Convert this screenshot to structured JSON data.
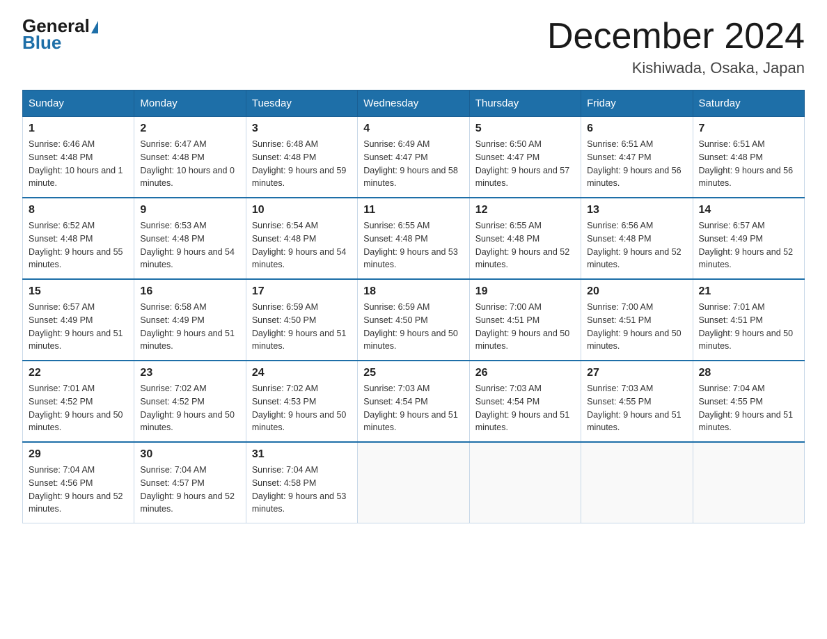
{
  "logo": {
    "general": "General",
    "blue": "Blue"
  },
  "title": "December 2024",
  "location": "Kishiwada, Osaka, Japan",
  "days_of_week": [
    "Sunday",
    "Monday",
    "Tuesday",
    "Wednesday",
    "Thursday",
    "Friday",
    "Saturday"
  ],
  "weeks": [
    [
      {
        "day": "1",
        "sunrise": "6:46 AM",
        "sunset": "4:48 PM",
        "daylight": "10 hours and 1 minute."
      },
      {
        "day": "2",
        "sunrise": "6:47 AM",
        "sunset": "4:48 PM",
        "daylight": "10 hours and 0 minutes."
      },
      {
        "day": "3",
        "sunrise": "6:48 AM",
        "sunset": "4:48 PM",
        "daylight": "9 hours and 59 minutes."
      },
      {
        "day": "4",
        "sunrise": "6:49 AM",
        "sunset": "4:47 PM",
        "daylight": "9 hours and 58 minutes."
      },
      {
        "day": "5",
        "sunrise": "6:50 AM",
        "sunset": "4:47 PM",
        "daylight": "9 hours and 57 minutes."
      },
      {
        "day": "6",
        "sunrise": "6:51 AM",
        "sunset": "4:47 PM",
        "daylight": "9 hours and 56 minutes."
      },
      {
        "day": "7",
        "sunrise": "6:51 AM",
        "sunset": "4:48 PM",
        "daylight": "9 hours and 56 minutes."
      }
    ],
    [
      {
        "day": "8",
        "sunrise": "6:52 AM",
        "sunset": "4:48 PM",
        "daylight": "9 hours and 55 minutes."
      },
      {
        "day": "9",
        "sunrise": "6:53 AM",
        "sunset": "4:48 PM",
        "daylight": "9 hours and 54 minutes."
      },
      {
        "day": "10",
        "sunrise": "6:54 AM",
        "sunset": "4:48 PM",
        "daylight": "9 hours and 54 minutes."
      },
      {
        "day": "11",
        "sunrise": "6:55 AM",
        "sunset": "4:48 PM",
        "daylight": "9 hours and 53 minutes."
      },
      {
        "day": "12",
        "sunrise": "6:55 AM",
        "sunset": "4:48 PM",
        "daylight": "9 hours and 52 minutes."
      },
      {
        "day": "13",
        "sunrise": "6:56 AM",
        "sunset": "4:48 PM",
        "daylight": "9 hours and 52 minutes."
      },
      {
        "day": "14",
        "sunrise": "6:57 AM",
        "sunset": "4:49 PM",
        "daylight": "9 hours and 52 minutes."
      }
    ],
    [
      {
        "day": "15",
        "sunrise": "6:57 AM",
        "sunset": "4:49 PM",
        "daylight": "9 hours and 51 minutes."
      },
      {
        "day": "16",
        "sunrise": "6:58 AM",
        "sunset": "4:49 PM",
        "daylight": "9 hours and 51 minutes."
      },
      {
        "day": "17",
        "sunrise": "6:59 AM",
        "sunset": "4:50 PM",
        "daylight": "9 hours and 51 minutes."
      },
      {
        "day": "18",
        "sunrise": "6:59 AM",
        "sunset": "4:50 PM",
        "daylight": "9 hours and 50 minutes."
      },
      {
        "day": "19",
        "sunrise": "7:00 AM",
        "sunset": "4:51 PM",
        "daylight": "9 hours and 50 minutes."
      },
      {
        "day": "20",
        "sunrise": "7:00 AM",
        "sunset": "4:51 PM",
        "daylight": "9 hours and 50 minutes."
      },
      {
        "day": "21",
        "sunrise": "7:01 AM",
        "sunset": "4:51 PM",
        "daylight": "9 hours and 50 minutes."
      }
    ],
    [
      {
        "day": "22",
        "sunrise": "7:01 AM",
        "sunset": "4:52 PM",
        "daylight": "9 hours and 50 minutes."
      },
      {
        "day": "23",
        "sunrise": "7:02 AM",
        "sunset": "4:52 PM",
        "daylight": "9 hours and 50 minutes."
      },
      {
        "day": "24",
        "sunrise": "7:02 AM",
        "sunset": "4:53 PM",
        "daylight": "9 hours and 50 minutes."
      },
      {
        "day": "25",
        "sunrise": "7:03 AM",
        "sunset": "4:54 PM",
        "daylight": "9 hours and 51 minutes."
      },
      {
        "day": "26",
        "sunrise": "7:03 AM",
        "sunset": "4:54 PM",
        "daylight": "9 hours and 51 minutes."
      },
      {
        "day": "27",
        "sunrise": "7:03 AM",
        "sunset": "4:55 PM",
        "daylight": "9 hours and 51 minutes."
      },
      {
        "day": "28",
        "sunrise": "7:04 AM",
        "sunset": "4:55 PM",
        "daylight": "9 hours and 51 minutes."
      }
    ],
    [
      {
        "day": "29",
        "sunrise": "7:04 AM",
        "sunset": "4:56 PM",
        "daylight": "9 hours and 52 minutes."
      },
      {
        "day": "30",
        "sunrise": "7:04 AM",
        "sunset": "4:57 PM",
        "daylight": "9 hours and 52 minutes."
      },
      {
        "day": "31",
        "sunrise": "7:04 AM",
        "sunset": "4:58 PM",
        "daylight": "9 hours and 53 minutes."
      },
      null,
      null,
      null,
      null
    ]
  ]
}
